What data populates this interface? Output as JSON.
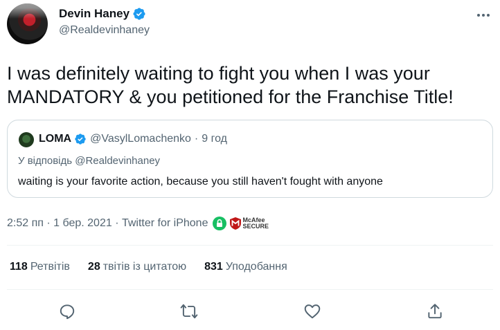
{
  "author": {
    "display_name": "Devin Haney",
    "handle": "@Realdevinhaney"
  },
  "tweet": {
    "line1": "I was definitely waiting to fight you when I was your",
    "line2": "MANDATORY & you petitioned for the Franchise Title!"
  },
  "quoted": {
    "display_name": "LOMA",
    "handle": "@VasylLomachenko",
    "separator": "·",
    "time": "9 год",
    "reply_to": "У відповідь @Realdevinhaney",
    "text": "waiting is your favorite action, because you still haven't fought with anyone"
  },
  "meta": {
    "timestamp": "2:52 пп · 1 бер. 2021 · Twitter for iPhone",
    "mcafee_line1": "McAfee",
    "mcafee_line2": "SECURE"
  },
  "stats": {
    "retweets_count": "118",
    "retweets_label": "Ретвітів",
    "quotes_count": "28",
    "quotes_label": "твітів із цитатою",
    "likes_count": "831",
    "likes_label": "Уподобання"
  },
  "colors": {
    "accent": "#1d9bf0",
    "secondary_text": "#536471",
    "border": "#cfd9de",
    "lock_green": "#17bf63",
    "mcafee_red": "#c01818"
  },
  "icons": {
    "verified": "verified-badge-icon",
    "more": "more-horizontal-icon",
    "reply": "reply-icon",
    "retweet": "retweet-icon",
    "like": "heart-icon",
    "share": "share-icon",
    "lock": "lock-icon",
    "mcafee": "mcafee-shield-icon"
  }
}
